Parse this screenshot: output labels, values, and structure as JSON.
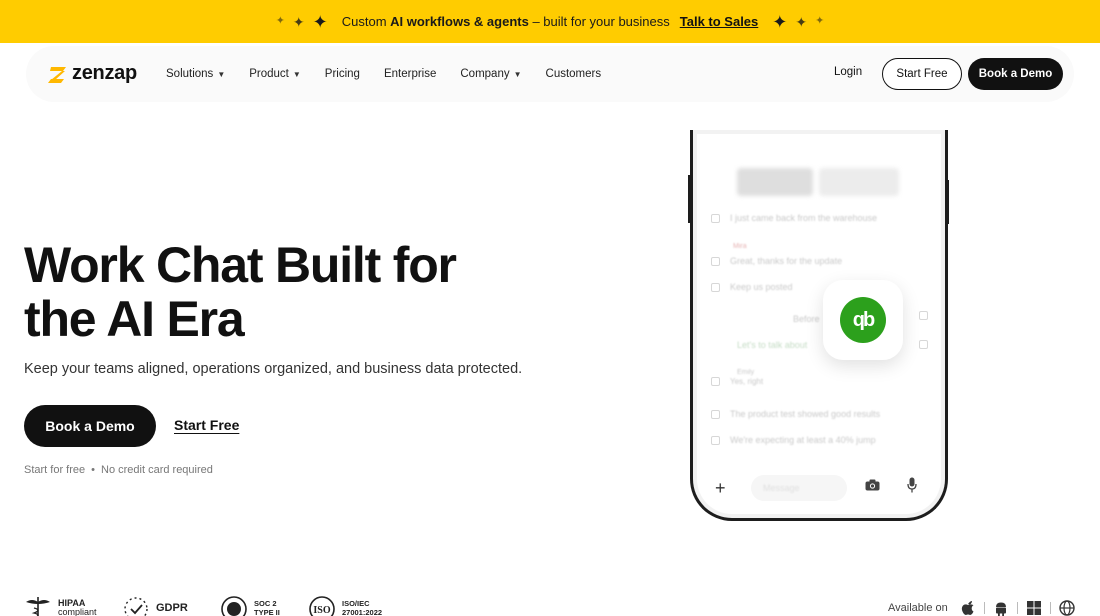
{
  "announcement": {
    "prefix": "Custom ",
    "highlight": "AI workflows & agents",
    "suffix": " – built for your business",
    "cta": "Talk to Sales"
  },
  "nav": {
    "brand": "zenzap",
    "items": [
      {
        "label": "Solutions",
        "has_dropdown": true
      },
      {
        "label": "Product",
        "has_dropdown": true
      },
      {
        "label": "Pricing",
        "has_dropdown": false
      },
      {
        "label": "Enterprise",
        "has_dropdown": false
      },
      {
        "label": "Company",
        "has_dropdown": true
      },
      {
        "label": "Customers",
        "has_dropdown": false
      }
    ],
    "login": "Login",
    "start_free": "Start Free",
    "book_demo": "Book a Demo"
  },
  "hero": {
    "title_line1": "Work Chat Built for",
    "title_line2": "the AI Era",
    "subtitle": "Keep your teams aligned, operations organized, and business data protected.",
    "primary_cta": "Book a Demo",
    "secondary_cta": "Start Free",
    "note_1": "Start for free",
    "note_sep": "•",
    "note_2": "No credit card required"
  },
  "phone": {
    "messages": [
      "I just came back from the warehouse",
      "Mira",
      "Great, thanks for the update",
      "Keep us posted",
      "Before",
      "Let's to talk about",
      "Emily",
      "Yes, right",
      "The product test showed good results",
      "We're expecting at least a 40% jump"
    ],
    "integration_glyph": "qb",
    "composer_placeholder": "Message"
  },
  "badges": {
    "hipaa_1": "HIPAA",
    "hipaa_2": "compliant",
    "gdpr": "GDPR",
    "soc_1": "SOC 2",
    "soc_2": "TYPE II",
    "iso_1": "ISO/IEC",
    "iso_2": "27001:2022"
  },
  "availability": {
    "label": "Available on",
    "platforms": [
      "apple-icon",
      "android-icon",
      "windows-icon",
      "web-icon"
    ]
  },
  "colors": {
    "announcement_bg": "#ffcc00",
    "primary": "#111111",
    "quickbooks_green": "#2ca01c"
  }
}
